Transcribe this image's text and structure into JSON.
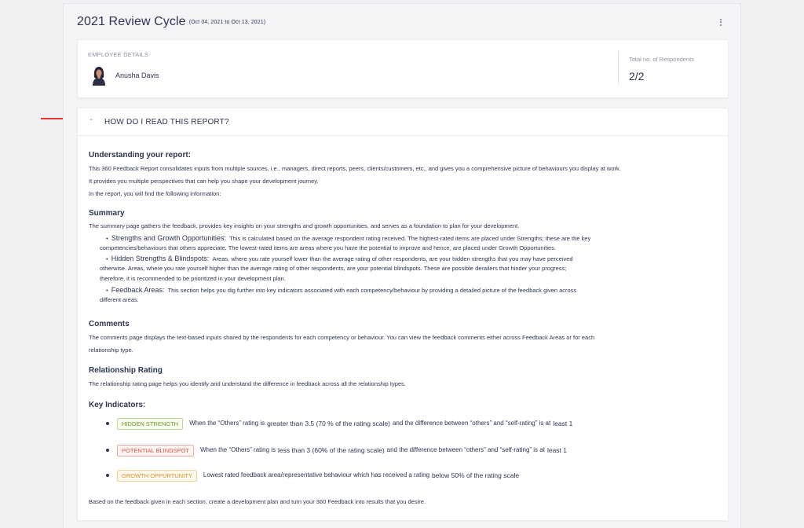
{
  "header": {
    "title": "2021 Review Cycle",
    "date_range": "(Oct 04, 2021 to Oct 13, 2021)",
    "menu_icon": "kebab-menu-icon"
  },
  "employee": {
    "section_label": "EMPLOYEE DETAILS",
    "name": "Anusha Davis",
    "respondents_label": "Total no. of Respondents",
    "respondents_value": "2/2"
  },
  "report_guide": {
    "title": "HOW DO I READ THIS REPORT?",
    "toggle_icon": "chevron-up-icon",
    "understanding_heading": "Understanding your report:",
    "understanding_line1": "This 360 Feedback Report consolidates inputs from multiple sources, i.e., managers, direct reports, peers, clients/customers, etc., and gives you a comprehensive picture of behaviours you display at work.",
    "understanding_line2": "It provides you multiple perspectives that can help you shape your development journey.",
    "understanding_line3": "In the report, you will find the following information:",
    "summary_heading": "Summary",
    "summary_text": "The summary page gathers the feedback, provides key insights on your strengths and growth opportunities, and serves as a foundation to plan for your development.",
    "bullets": [
      {
        "title": "Strengths and Growth Opportunities:",
        "line1": "This is calculated based on the average respondent rating received. The highest-rated items are placed under Strengths; these are the key",
        "line2": "competencies/behaviours that others appreciate. The lowest-rated items are areas where you have the potential to improve and hence, are placed under Growth Opportunities."
      },
      {
        "title": "Hidden Strengths & Blindspots:",
        "line1": "Areas, where you rate yourself lower than the average rating of other respondents, are your hidden strengths that you may have perceived",
        "line2": "otherwise. Areas, where you rate yourself higher than the average rating of other respondents, are your potential blindspots. These are possible derailers that hinder your progress;",
        "line3": "therefore, it is recommended to be prioritized in your development plan."
      },
      {
        "title": "Feedback Areas:",
        "line1": "This section helps you dig further into key indicators associated with each competency/behaviour by providing a detailed picture of the feedback given across",
        "line2": "different areas."
      }
    ],
    "comments_heading": "Comments",
    "comments_line1": "The comments page displays the text-based inputs shared by the respondents for each competency or behaviour. You can view the feedback comments either across Feedback Areas or for each",
    "comments_line2": "relationship type.",
    "relationship_heading": "Relationship Rating",
    "relationship_text": "The relationship rating page helps you identify and understand the difference in feedback across all the relationship types.",
    "key_heading": "Key Indicators:",
    "indicators": [
      {
        "badge": "HIDDEN STRENGTH",
        "t1": "When the “Others” rating is",
        "e1": "greater than 3.5 (70 % of the rating scale)",
        "t2": "and the difference between “others” and “self-rating” is at",
        "e2": "least 1"
      },
      {
        "badge": "POTENTIAL BLINDSPOT",
        "t1": "When the “Others” rating is",
        "e1": "less than 3 (60% of the rating scale)",
        "t2": "and the difference between “others” and “self-rating” is at",
        "e2": "least 1"
      },
      {
        "badge": "GROWTH OPPURTUNITY",
        "t1": "Lowest rated feedback area/representative behaviour which has received a rating",
        "e1": "below 50% of the rating scale"
      }
    ],
    "closing": "Based on the feedback given in each section, create a development plan and turn your 360 Feedback into results that you desire."
  },
  "colors": {
    "accent_arrow": "#e8312a",
    "text": "#2b3550",
    "badge_green": "#6a9a1f",
    "badge_red": "#e0503f",
    "badge_orange": "#d6941f"
  }
}
